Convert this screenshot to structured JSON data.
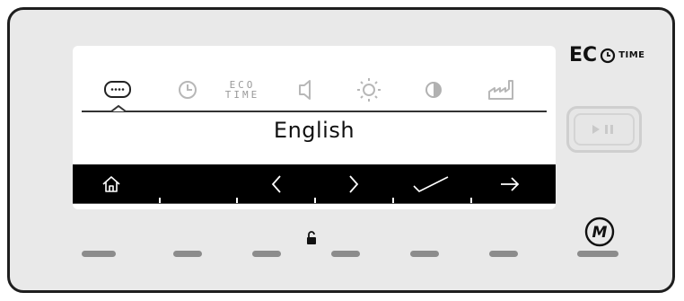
{
  "display": {
    "language_label": "English",
    "icons": [
      "language-icon",
      "clock-icon",
      "eco-time-icon",
      "volume-icon",
      "brightness-icon",
      "contrast-icon",
      "factory-reset-icon"
    ],
    "eco_icon_text_line1": "ECO",
    "eco_icon_text_line2": "TIME"
  },
  "nav_bar": {
    "buttons": [
      "home-icon",
      "arrow-left-icon",
      "arrow-right-icon",
      "confirm-check-icon",
      "next-arrow-icon"
    ]
  },
  "branding": {
    "eco_logo_text": "EC",
    "eco_logo_suffix": "TIME"
  },
  "controls": {
    "start_pause_button": "start-pause-icon",
    "program_memory_button": "M",
    "lock_indicator": "lock-icon",
    "hardware_key_count": 7
  },
  "colors": {
    "panel_bg": "#e9e9e9",
    "panel_border": "#1e1e1e",
    "screen_bg": "#ffffff",
    "nav_bar_bg": "#000000",
    "key_color": "#8c8c8c"
  }
}
